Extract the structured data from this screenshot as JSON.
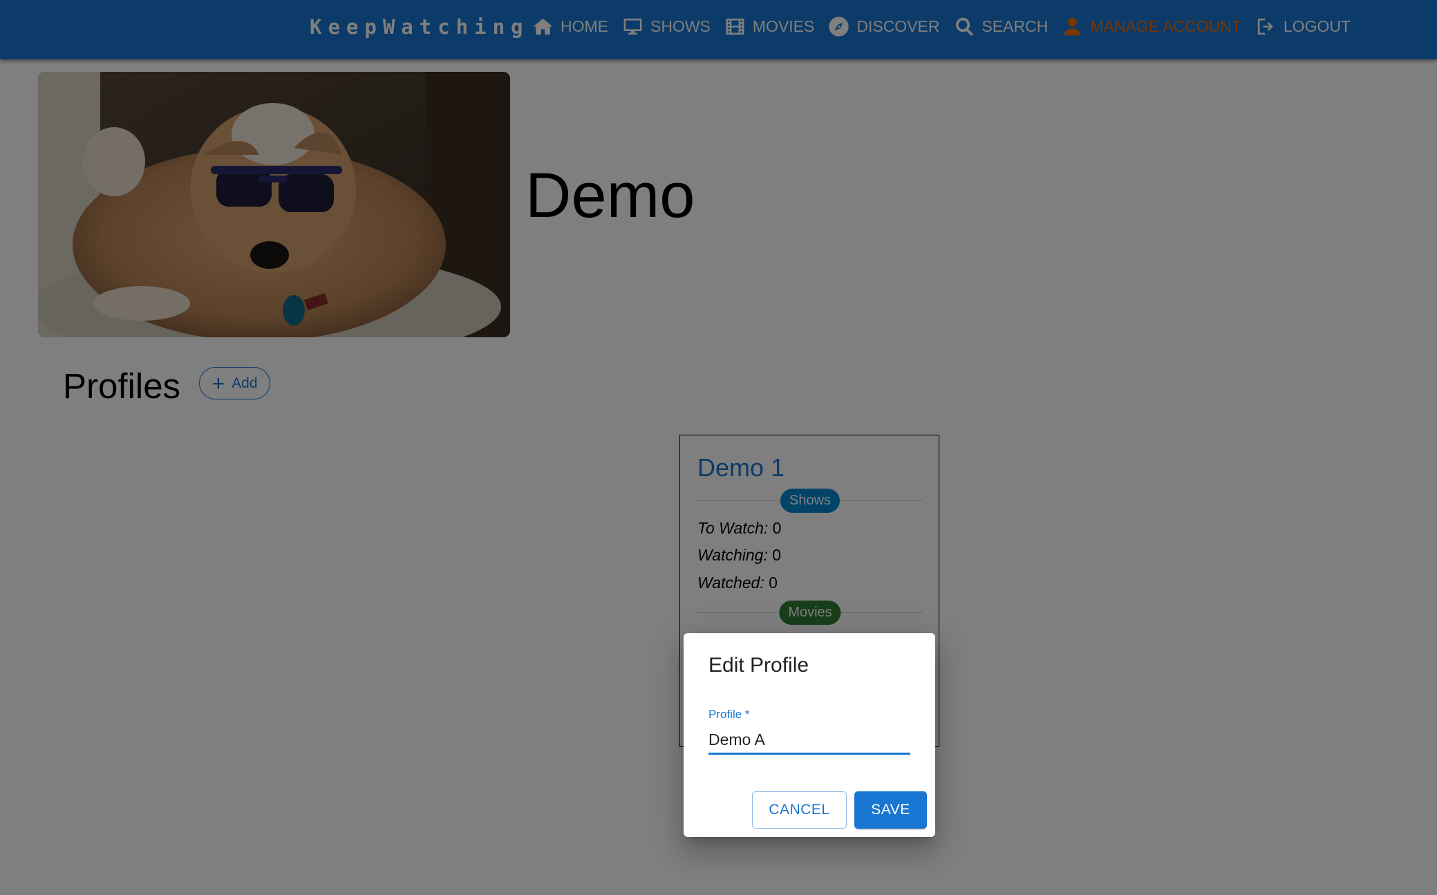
{
  "app": {
    "brand": "KeepWatching"
  },
  "nav": {
    "items": [
      {
        "label": "HOME",
        "icon": "home-icon"
      },
      {
        "label": "SHOWS",
        "icon": "tv-icon"
      },
      {
        "label": "MOVIES",
        "icon": "film-icon"
      },
      {
        "label": "DISCOVER",
        "icon": "compass-icon"
      },
      {
        "label": "SEARCH",
        "icon": "search-icon"
      },
      {
        "label": "MANAGE ACCOUNT",
        "icon": "user-icon",
        "active": true
      },
      {
        "label": "LOGOUT",
        "icon": "logout-icon"
      }
    ],
    "active_color": "#ed6c02",
    "bar_color": "#1976d2"
  },
  "account": {
    "name": "Demo",
    "photo": "dog-with-sunglasses"
  },
  "profiles": {
    "title": "Profiles",
    "add_label": "Add",
    "cards": [
      {
        "name": "Demo 1",
        "shows_chip": "Shows",
        "stats": [
          {
            "label": "To Watch:",
            "value": "0"
          },
          {
            "label": "Watching:",
            "value": "0"
          },
          {
            "label": "Watched:",
            "value": "0"
          }
        ],
        "movies_chip": "Movies"
      }
    ]
  },
  "dialog": {
    "title": "Edit Profile",
    "field_label": "Profile *",
    "field_value": "Demo A",
    "cancel_label": "CANCEL",
    "save_label": "SAVE"
  }
}
